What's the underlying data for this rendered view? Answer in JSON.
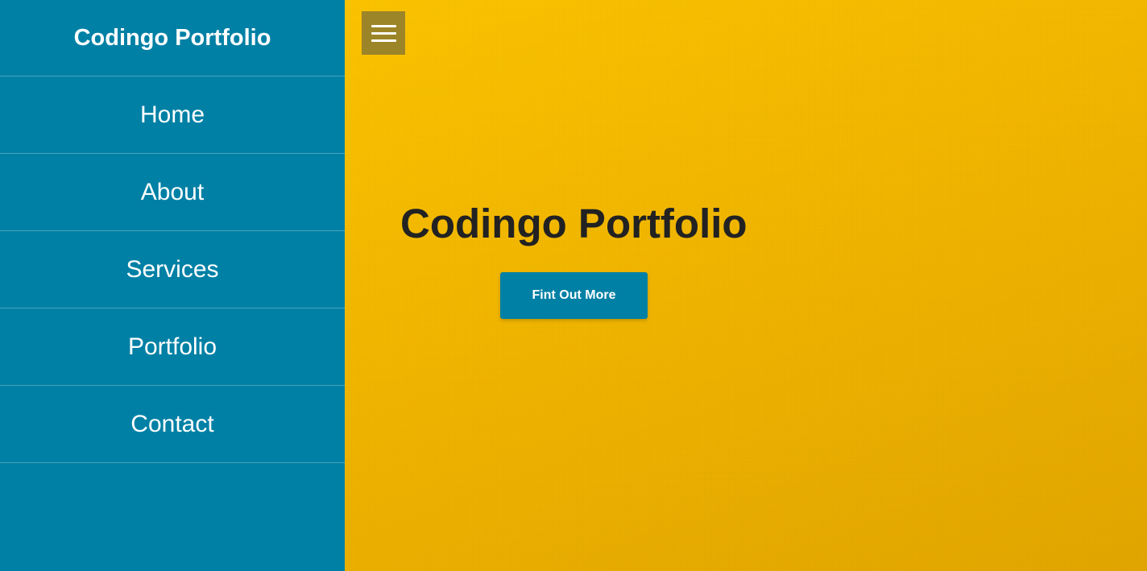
{
  "sidebar": {
    "brand": "Codingo Portfolio",
    "items": [
      {
        "label": "Home"
      },
      {
        "label": "About"
      },
      {
        "label": "Services"
      },
      {
        "label": "Portfolio"
      },
      {
        "label": "Contact"
      }
    ]
  },
  "header": {
    "menu_icon": "hamburger-menu-icon"
  },
  "hero": {
    "title": "Codingo Portfolio",
    "button_label": "Fint Out More"
  },
  "colors": {
    "sidebar_bg": "#0080a5",
    "hero_bg": "#f5bc00",
    "menu_toggle_bg": "#9c8428",
    "title_text": "#222222",
    "button_bg": "#0080a5"
  }
}
